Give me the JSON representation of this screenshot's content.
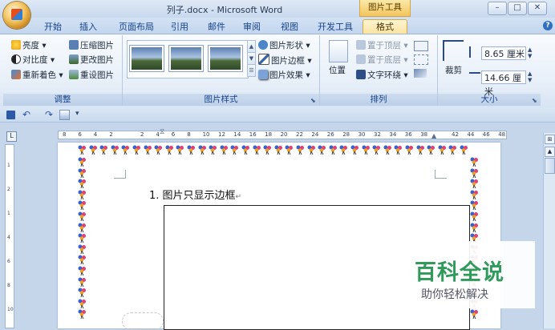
{
  "window": {
    "title": "列子.docx - Microsoft Word",
    "context_tab_group": "图片工具",
    "controls": [
      "–",
      "□",
      "✕"
    ]
  },
  "tabs": [
    "开始",
    "插入",
    "页面布局",
    "引用",
    "邮件",
    "审阅",
    "视图",
    "开发工具",
    "格式"
  ],
  "active_tab": "格式",
  "ribbon": {
    "adjust": {
      "label": "调整",
      "items": [
        "亮度 ▾",
        "对比度 ▾",
        "重新着色 ▾",
        "压缩图片",
        "更改图片",
        "重设图片"
      ]
    },
    "picture_styles": {
      "label": "图片样式",
      "items": [
        "图片形状 ▾",
        "图片边框 ▾",
        "图片效果 ▾"
      ]
    },
    "arrange": {
      "label": "排列",
      "position": "位置",
      "items": [
        "置于顶层 ▾",
        "置于底层 ▾",
        "文字环绕 ▾"
      ]
    },
    "size": {
      "label": "大小",
      "crop": "裁剪",
      "height": "8.65 厘米",
      "width": "14.66 厘米"
    }
  },
  "qat": {
    "more": "▾"
  },
  "ruler": {
    "corner": "L",
    "ticks": [
      "8",
      "6",
      "4",
      "2",
      "",
      "2",
      "4",
      "6",
      "8",
      "10",
      "12",
      "14",
      "16",
      "18",
      "20",
      "22",
      "24",
      "26",
      "28",
      "30",
      "32",
      "34",
      "36",
      "38",
      "",
      "42",
      "44",
      "46",
      "48"
    ]
  },
  "document": {
    "paragraph": "1. 图片只显示边框",
    "paragraph_mark": "↵"
  },
  "watermark": {
    "title": "百科全说",
    "subtitle": "助你轻松解决"
  },
  "colors": {
    "accent": "#15428b",
    "context_tab": "#f2c65d",
    "watermark_green": "#2f9a5a"
  }
}
